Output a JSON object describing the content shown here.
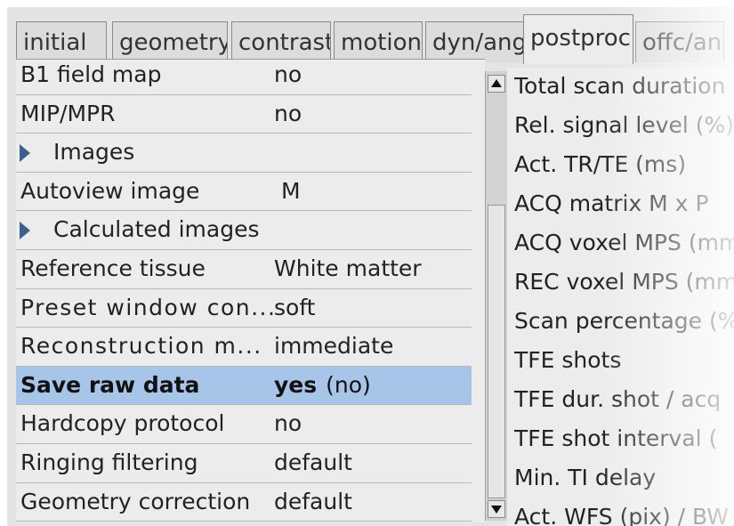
{
  "tabs": [
    {
      "label": "initial",
      "active": false
    },
    {
      "label": "geometry",
      "active": false
    },
    {
      "label": "contrast",
      "active": false
    },
    {
      "label": "motion",
      "active": false
    },
    {
      "label": "dyn/ang",
      "active": false
    },
    {
      "label": "postproc",
      "active": true
    },
    {
      "label": "offc/ang",
      "active": false
    }
  ],
  "params": [
    {
      "label": "B1 field map",
      "value": "no",
      "type": "param"
    },
    {
      "label": "MIP/MPR",
      "value": "no",
      "type": "param"
    },
    {
      "label": "Images",
      "value": "",
      "type": "group"
    },
    {
      "label": "Autoview image",
      "value": "M",
      "type": "param"
    },
    {
      "label": "Calculated images",
      "value": "",
      "type": "group"
    },
    {
      "label": "Reference tissue",
      "value": "White matter",
      "type": "param"
    },
    {
      "label": "Preset window con...",
      "value": "soft",
      "type": "param"
    },
    {
      "label": "Reconstruction m...",
      "value": "immediate",
      "type": "param"
    },
    {
      "label": "Save raw data",
      "value": "yes",
      "extra": "(no)",
      "type": "param",
      "selected": true
    },
    {
      "label": "Hardcopy protocol",
      "value": "no",
      "type": "param"
    },
    {
      "label": "Ringing filtering",
      "value": "default",
      "type": "param"
    },
    {
      "label": "Geometry correction",
      "value": "default",
      "type": "param"
    }
  ],
  "info_panel": [
    "Total scan duration",
    "Rel. signal level (%)",
    "Act. TR/TE (ms)",
    "ACQ matrix M x P",
    "ACQ voxel MPS (mm)",
    "REC voxel MPS (mm)",
    "Scan percentage (%)",
    "TFE shots",
    "TFE dur. shot / acq",
    "TFE shot interval (",
    "Min. TI delay",
    "Act. WFS (pix) / BW"
  ]
}
